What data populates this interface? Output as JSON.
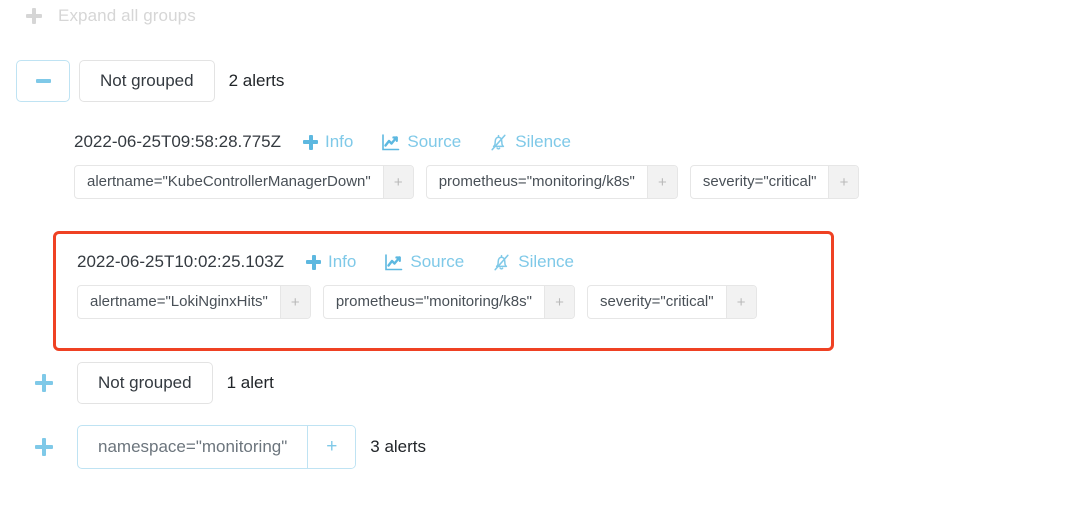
{
  "toolbar": {
    "expand_all_label": "Expand all groups",
    "expand_all_icon": "plus-icon"
  },
  "colors": {
    "accent_blue": "#7fc9e8",
    "link_blue": "#5db8e0",
    "highlight_red": "#ef4123",
    "chip_border": "#e6e6e6",
    "muted_text": "#6c757d",
    "disabled_text": "#d6d6d6"
  },
  "actions": {
    "info_label": "Info",
    "info_icon": "plus-icon",
    "source_label": "Source",
    "source_icon": "chart-line-icon",
    "silence_label": "Silence",
    "silence_icon": "bell-slash-icon"
  },
  "groups": [
    {
      "name": "Not grouped",
      "count_label": "2 alerts",
      "expanded": true,
      "toggle_icon": "minus-icon",
      "alerts": [
        {
          "timestamp": "2022-06-25T09:58:28.775Z",
          "highlighted": false,
          "labels": [
            {
              "text": "alertname=\"KubeControllerManagerDown\"",
              "add_label": "+"
            },
            {
              "text": "prometheus=\"monitoring/k8s\"",
              "add_label": "+"
            },
            {
              "text": "severity=\"critical\"",
              "add_label": "+"
            }
          ]
        },
        {
          "timestamp": "2022-06-25T10:02:25.103Z",
          "highlighted": true,
          "labels": [
            {
              "text": "alertname=\"LokiNginxHits\"",
              "add_label": "+"
            },
            {
              "text": "prometheus=\"monitoring/k8s\"",
              "add_label": "+"
            },
            {
              "text": "severity=\"critical\"",
              "add_label": "+"
            }
          ]
        }
      ]
    },
    {
      "name": "Not grouped",
      "count_label": "1 alert",
      "expanded": false,
      "toggle_icon": "plus-icon",
      "alerts": []
    },
    {
      "name": "namespace=\"monitoring\"",
      "name_is_chip": true,
      "chip_add_label": "+",
      "count_label": "3 alerts",
      "expanded": false,
      "toggle_icon": "plus-icon",
      "alerts": []
    }
  ]
}
